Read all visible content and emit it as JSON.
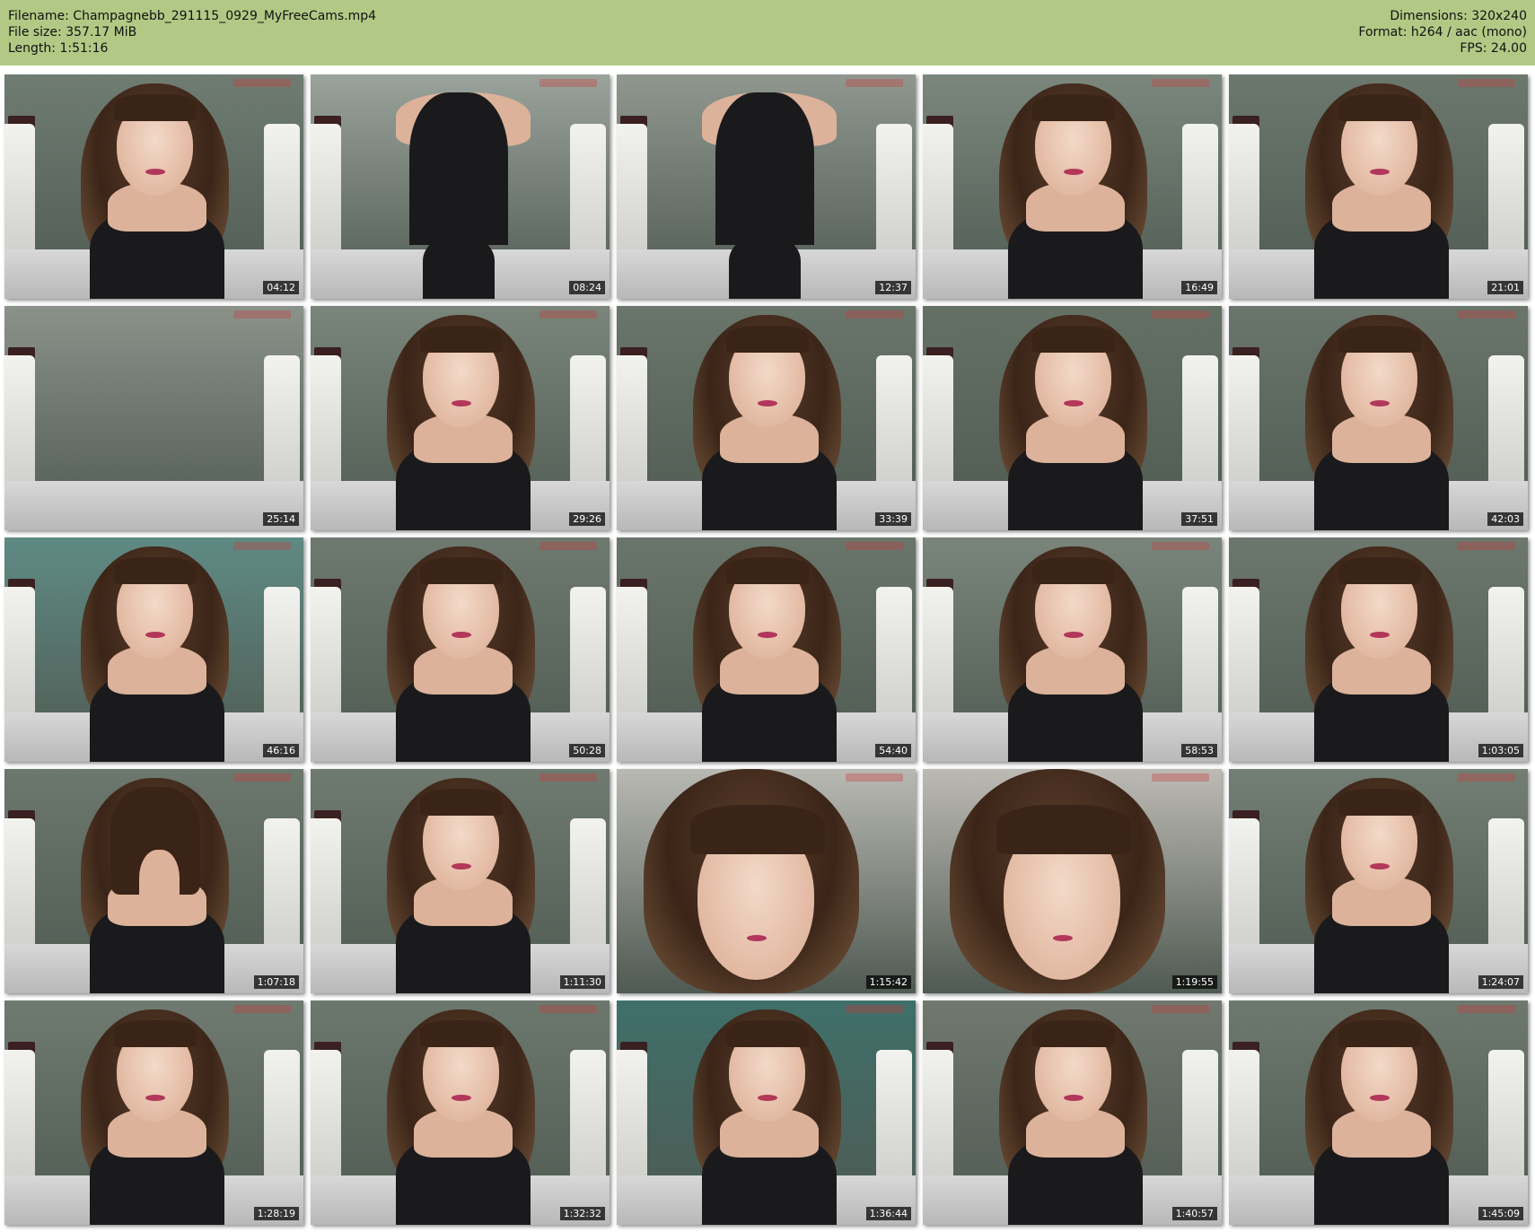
{
  "header": {
    "filename": "Filename: Champagnebb_291115_0929_MyFreeCams.mp4",
    "file_size": "File size: 357.17 MiB",
    "length": "Length: 1:51:16",
    "dimensions": "Dimensions: 320x240",
    "format": "Format: h264 / aac (mono)",
    "fps": "FPS: 24.00",
    "background_color": "#b2c985"
  },
  "thumbnails": [
    {
      "time": "04:12"
    },
    {
      "time": "08:24"
    },
    {
      "time": "12:37"
    },
    {
      "time": "16:49"
    },
    {
      "time": "21:01"
    },
    {
      "time": "25:14"
    },
    {
      "time": "29:26"
    },
    {
      "time": "33:39"
    },
    {
      "time": "37:51"
    },
    {
      "time": "42:03"
    },
    {
      "time": "46:16"
    },
    {
      "time": "50:28"
    },
    {
      "time": "54:40"
    },
    {
      "time": "58:53"
    },
    {
      "time": "1:03:05"
    },
    {
      "time": "1:07:18"
    },
    {
      "time": "1:11:30"
    },
    {
      "time": "1:15:42"
    },
    {
      "time": "1:19:55"
    },
    {
      "time": "1:24:07"
    },
    {
      "time": "1:28:19"
    },
    {
      "time": "1:32:32"
    },
    {
      "time": "1:36:44"
    },
    {
      "time": "1:40:57"
    },
    {
      "time": "1:45:09"
    }
  ]
}
